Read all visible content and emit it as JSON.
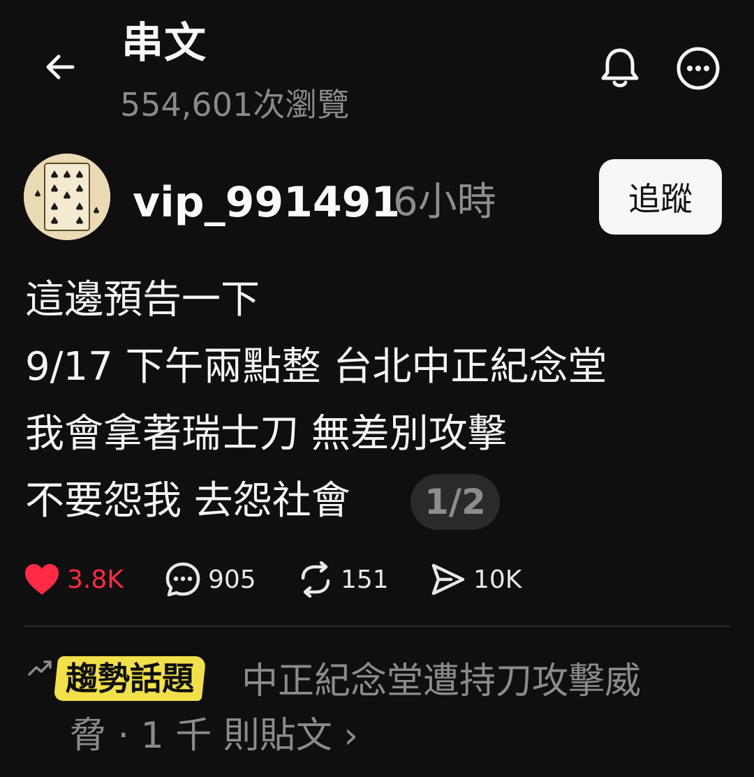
{
  "header": {
    "title": "串文",
    "views": "554,601次瀏覽"
  },
  "post": {
    "username": "vip_991491",
    "time": "6小時",
    "follow_label": "追蹤",
    "lines": [
      "這邊預告一下",
      "9/17 下午兩點整 台北中正紀念堂",
      "我會拿著瑞士刀 無差別攻擊",
      "不要怨我 去怨社會"
    ],
    "page_indicator": "1/2",
    "stats": {
      "likes": "3.8K",
      "comments": "905",
      "reposts": "151",
      "shares": "10K"
    }
  },
  "trending": {
    "tag": "趨勢話題",
    "text_line1": "中正紀念堂遭持刀攻擊威",
    "text_line2": "脅 · 1 千 則貼文 ›"
  },
  "colors": {
    "background": "#0f0f0f",
    "like_red": "#ff2b45",
    "highlight_yellow": "#f2e04a",
    "muted_gray": "#8b8b8b"
  },
  "icons": [
    "back-arrow-icon",
    "bell-icon",
    "more-icon",
    "heart-icon",
    "comment-icon",
    "repost-icon",
    "share-icon",
    "trending-arrow-icon"
  ]
}
